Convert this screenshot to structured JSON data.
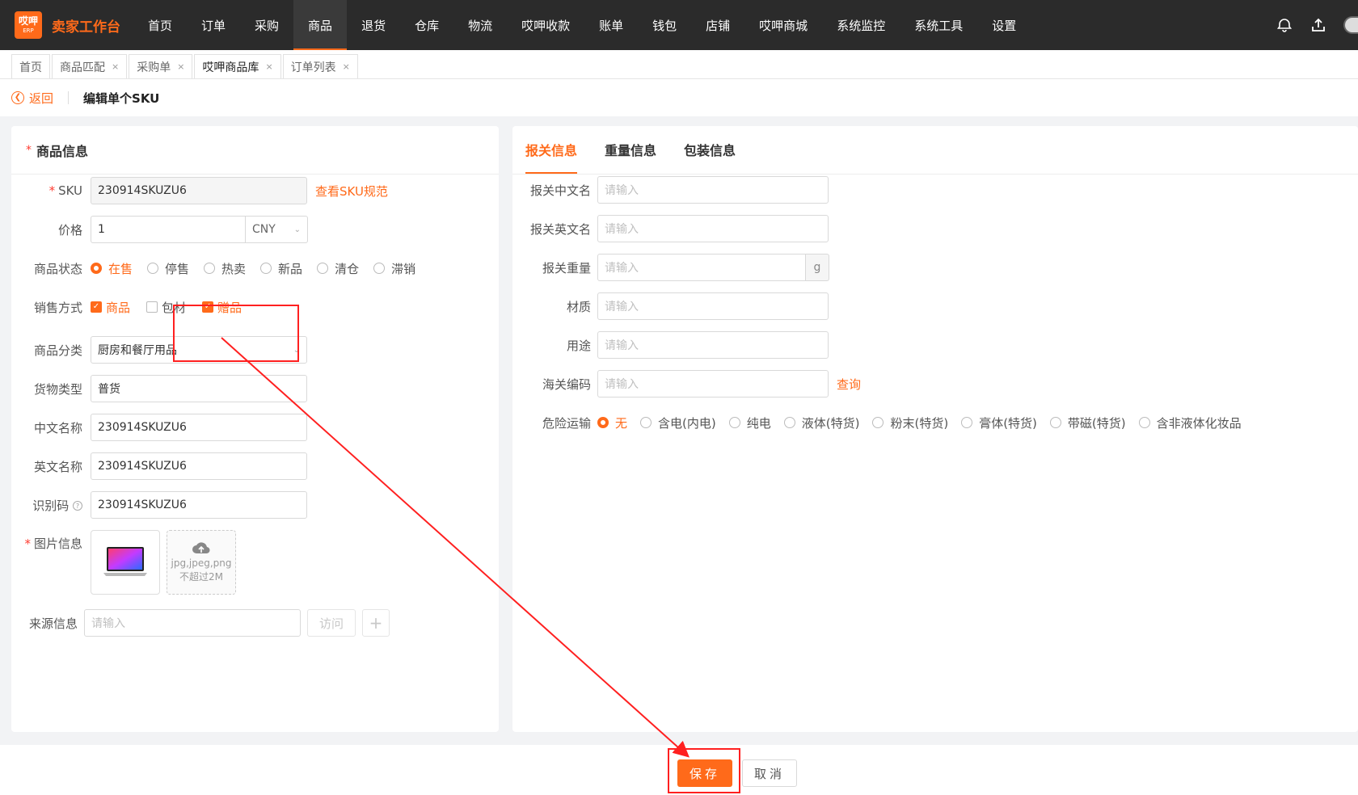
{
  "brand": {
    "logo_line1": "哎呷",
    "logo_line2": "ERP",
    "name": "卖家工作台"
  },
  "nav": [
    {
      "label": "首页"
    },
    {
      "label": "订单"
    },
    {
      "label": "采购"
    },
    {
      "label": "商品"
    },
    {
      "label": "退货"
    },
    {
      "label": "仓库"
    },
    {
      "label": "物流"
    },
    {
      "label": "哎呷收款"
    },
    {
      "label": "账单"
    },
    {
      "label": "钱包"
    },
    {
      "label": "店铺"
    },
    {
      "label": "哎呷商城"
    },
    {
      "label": "系统监控"
    },
    {
      "label": "系统工具"
    },
    {
      "label": "设置"
    }
  ],
  "nav_active": "商品",
  "tabs": [
    {
      "label": "首页"
    },
    {
      "label": "商品匹配"
    },
    {
      "label": "采购单"
    },
    {
      "label": "哎呷商品库"
    },
    {
      "label": "订单列表"
    }
  ],
  "tab_close": "×",
  "breadcrumb": {
    "back": "返回",
    "title": "编辑单个SKU"
  },
  "left": {
    "title": "商品信息",
    "sku": {
      "label": "SKU",
      "value": "230914SKUZU6",
      "link": "查看SKU规范"
    },
    "price": {
      "label": "价格",
      "value": "1",
      "currency": "CNY"
    },
    "status": {
      "label": "商品状态",
      "options": [
        "在售",
        "停售",
        "热卖",
        "新品",
        "清仓",
        "滞销"
      ],
      "selected": "在售"
    },
    "sale": {
      "label": "销售方式",
      "options": [
        {
          "label": "商品",
          "checked": true
        },
        {
          "label": "包材",
          "checked": false
        },
        {
          "label": "赠品",
          "checked": true
        }
      ]
    },
    "category": {
      "label": "商品分类",
      "value": "厨房和餐厅用品"
    },
    "goods_type": {
      "label": "货物类型",
      "value": "普货"
    },
    "cn_name": {
      "label": "中文名称",
      "value": "230914SKUZU6"
    },
    "en_name": {
      "label": "英文名称",
      "value": "230914SKUZU6"
    },
    "ident": {
      "label": "识别码",
      "value": "230914SKUZU6"
    },
    "images": {
      "label": "图片信息",
      "upload_line1": "jpg,jpeg,png",
      "upload_line2": "不超过2M"
    },
    "source": {
      "label": "来源信息",
      "placeholder": "请输入",
      "visit": "访问",
      "add": "+"
    }
  },
  "right": {
    "tabs": [
      {
        "label": "报关信息"
      },
      {
        "label": "重量信息"
      },
      {
        "label": "包装信息"
      }
    ],
    "active_tab": "报关信息",
    "fields": {
      "cn_name": {
        "label": "报关中文名",
        "placeholder": "请输入"
      },
      "en_name": {
        "label": "报关英文名",
        "placeholder": "请输入"
      },
      "weight": {
        "label": "报关重量",
        "placeholder": "请输入",
        "unit": "g"
      },
      "material": {
        "label": "材质",
        "placeholder": "请输入"
      },
      "usage": {
        "label": "用途",
        "placeholder": "请输入"
      },
      "hs_code": {
        "label": "海关编码",
        "placeholder": "请输入",
        "link": "查询"
      }
    },
    "danger": {
      "label": "危险运输",
      "options": [
        "无",
        "含电(内电)",
        "纯电",
        "液体(特货)",
        "粉末(特货)",
        "膏体(特货)",
        "带磁(特货)",
        "含非液体化妆品"
      ],
      "selected": "无"
    }
  },
  "footer": {
    "save": "保存",
    "cancel": "取消"
  },
  "colors": {
    "accent": "#ff6a1a",
    "annotation": "#ff2020",
    "topbar": "#2b2b2b"
  }
}
